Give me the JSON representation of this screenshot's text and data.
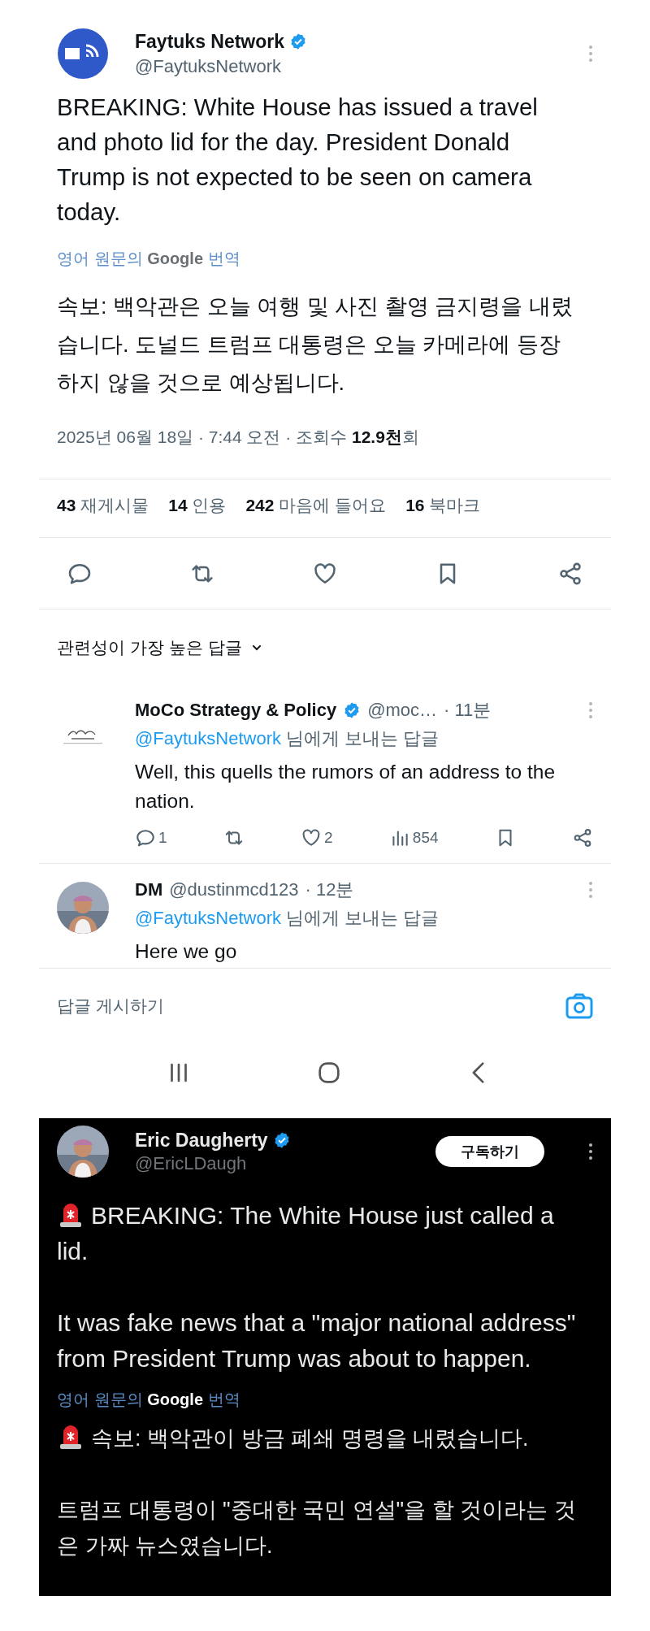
{
  "tweet": {
    "author": {
      "name": "Faytuks Network",
      "handle": "@FaytuksNetwork",
      "verified": true
    },
    "text": "BREAKING: White House has issued a travel and photo lid for the day. President Donald Trump is not expected to be seen on camera today.",
    "translate_link": {
      "before": "영어 원문의",
      "brand": "Google",
      "after": "번역"
    },
    "translation": "속보: 백악관은 오늘 여행 및 사진 촬영 금지령을 내렸습니다. 도널드 트럼프 대통령은 오늘 카메라에 등장하지 않을 것으로 예상됩니다.",
    "meta": "2025년 06월 18일 · 7:44 오전 · 조회수 **12.9천**회",
    "stats": [
      {
        "count": "43",
        "label": "재게시물"
      },
      {
        "count": "14",
        "label": "인용"
      },
      {
        "count": "242",
        "label": "마음에 들어요"
      },
      {
        "count": "16",
        "label": "북마크"
      }
    ],
    "actions": [
      {
        "kind": "reply"
      },
      {
        "kind": "repost"
      },
      {
        "kind": "like"
      },
      {
        "kind": "bookmark"
      },
      {
        "kind": "share"
      }
    ]
  },
  "replies_sort": "관련성이 가장 높은 답글",
  "replies": [
    {
      "kind": "brand",
      "name": "MoCo Strategy & Policy",
      "verified": true,
      "handle": "@moc…",
      "time": "· 11분",
      "reply_to": "@FaytuksNetwork",
      "reply_to_suffix": "님에게 보내는 답글",
      "text": "Well, this quells the rumors of an address to the nation.",
      "actions": [
        {
          "kind": "reply",
          "count": "1"
        },
        {
          "kind": "repost"
        },
        {
          "kind": "like",
          "count": "2"
        },
        {
          "kind": "views",
          "count": "854"
        },
        {
          "kind": "bookmark"
        },
        {
          "kind": "share"
        }
      ]
    },
    {
      "kind": "person",
      "name": "DM",
      "verified": false,
      "handle": "@dustinmcd123",
      "time": "· 12분",
      "reply_to": "@FaytuksNetwork",
      "reply_to_suffix": "님에게 보내는 답글",
      "text": "Here we go"
    }
  ],
  "compose": {
    "placeholder": "답글 게시하기"
  },
  "nav_bar": [
    {
      "kind": "recents"
    },
    {
      "kind": "home"
    },
    {
      "kind": "back"
    }
  ],
  "second_tweet": {
    "author": {
      "name": "Eric Daugherty",
      "handle": "@EricLDaugh",
      "verified": true
    },
    "subscribe_button": "구독하기",
    "paragraphs": [
      {
        "text": "BREAKING: The White House just called a lid.",
        "siren": true
      },
      {
        "text": "It was fake news that a \"major national address\" from President Trump was about to happen.",
        "siren": false
      }
    ],
    "translate_link": {
      "before": "영어 원문의",
      "brand": "Google",
      "after": "번역"
    },
    "translation": [
      {
        "text": "속보: 백악관이 방금 폐쇄 명령을 내렸습니다.",
        "siren": true
      },
      {
        "text": "트럼프 대통령이 \"중대한 국민 연설\"을 할 것이라는 것은 가짜 뉴스였습니다.",
        "siren": false
      }
    ]
  }
}
